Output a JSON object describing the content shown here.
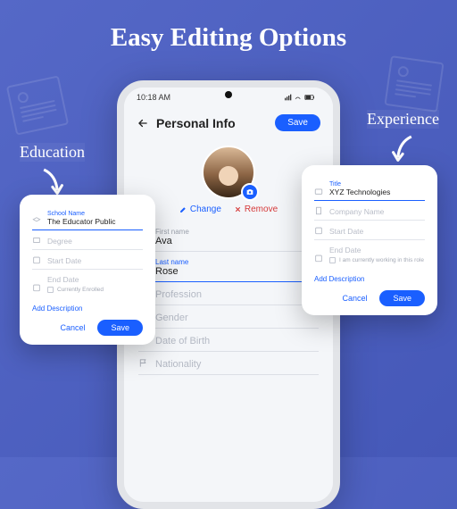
{
  "title": "Easy Editing Options",
  "callouts": {
    "education": "Education",
    "experience": "Experience"
  },
  "statusbar": {
    "time": "10:18 AM"
  },
  "header": {
    "title": "Personal Info",
    "save": "Save"
  },
  "avatar_actions": {
    "change": "Change",
    "remove": "Remove"
  },
  "fields": {
    "first_name": {
      "label": "First name",
      "value": "Ava"
    },
    "last_name": {
      "label": "Last name",
      "value": "Rose"
    },
    "profession": {
      "placeholder": "Profession"
    },
    "gender": {
      "placeholder": "Gender"
    },
    "dob": {
      "placeholder": "Date of Birth"
    },
    "nationality": {
      "placeholder": "Nationality"
    }
  },
  "education_card": {
    "school_label": "School Name",
    "school_value": "The Educator Public",
    "degree": "Degree",
    "start_date": "Start Date",
    "end_date": "End Date",
    "enrolled": "Currently Enrolled",
    "add_desc": "Add Description",
    "cancel": "Cancel",
    "save": "Save"
  },
  "experience_card": {
    "title_label": "Title",
    "title_value": "XYZ Technologies",
    "company": "Company Name",
    "start_date": "Start Date",
    "end_date": "End Date",
    "working": "I am currently working in this role",
    "add_desc": "Add Description",
    "cancel": "Cancel",
    "save": "Save"
  }
}
